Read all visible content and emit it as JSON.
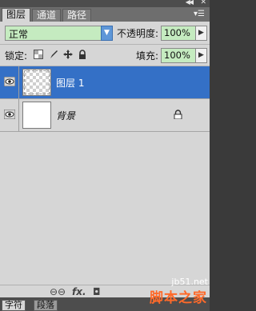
{
  "tabs": [
    "图层",
    "通道",
    "路径"
  ],
  "controls": {
    "blend_mode": "正常",
    "opacity_label": "不透明度:",
    "opacity_value": "100%",
    "lock_label": "锁定:",
    "fill_label": "填充:",
    "fill_value": "100%"
  },
  "layers": [
    {
      "name": "图层 1",
      "selected": true,
      "thumbnail": "transparent"
    },
    {
      "name": "背景",
      "selected": false,
      "thumbnail": "white",
      "locked": true
    }
  ],
  "bottom_toolbar_icons": [
    "link-layers-icon",
    "fx-icon",
    "mask-icon"
  ],
  "bottom_tabs": [
    "字符",
    "段落"
  ],
  "watermark": {
    "url": "jb51.net",
    "brand": "脚本之家"
  },
  "colors": {
    "selection": "#3470c6",
    "panel_bg": "#d6d6d6",
    "field_bg": "#c5ebc0",
    "watermark": "#ff6a2a"
  }
}
